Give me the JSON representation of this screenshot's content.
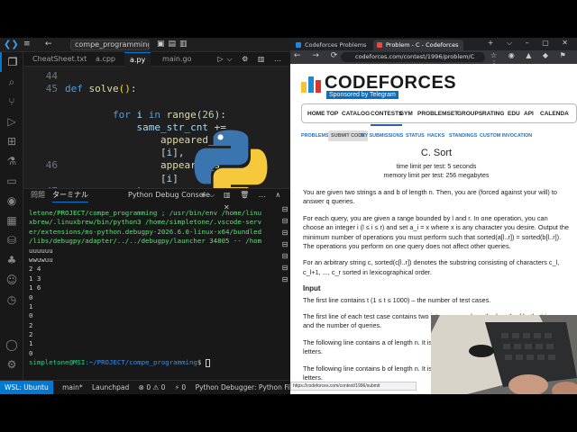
{
  "vscode": {
    "menu_icon": "≡",
    "nav_back": "←",
    "nav_fwd": "→",
    "search_text": "compe_programming [WS...",
    "tabs": [
      {
        "label": "CheatSheet.txt",
        "active": false
      },
      {
        "label": "a.cpp",
        "active": false
      },
      {
        "label": "a.py",
        "active": true
      },
      {
        "label": "main.go",
        "active": false
      }
    ],
    "editor_lines": [
      {
        "num": "44",
        "html": ""
      },
      {
        "num": "45",
        "html": "<span class=\"kw\">def</span> <span class=\"fn\">solve</span><span class=\"pn\">()</span>:"
      },
      {
        "num": "",
        "html": ""
      },
      {
        "num": "",
        "html": "        <span class=\"kw\">for</span> <span class=\"vr\">i</span> <span class=\"kw\">in</span> <span class=\"fn\">range</span>(<span class=\"nm\">26</span>):"
      },
      {
        "num": "",
        "html": "            <span class=\"vr\">same_str_cnt</span> +="
      },
      {
        "num": "",
        "html": "                <span class=\"fn\">appeared_s</span>            <span class=\"vr\">terval</span>"
      },
      {
        "num": "",
        "html": "                [<span class=\"vr\">i</span>],"
      },
      {
        "num": "46",
        "html": "                <span class=\"fn\">appeared_s</span>            <span class=\"vr\">terval</span>"
      },
      {
        "num": "",
        "html": "                [<span class=\"vr\">i</span>]"
      },
      {
        "num": "47",
        "html": "            )"
      },
      {
        "num": "",
        "html": ""
      }
    ],
    "panel_tabs": {
      "problems": "問題",
      "terminal": "ターミナル",
      "debug": "Python Debug Console",
      "plus": "+",
      "split": "⌵"
    },
    "terminal_lines": [
      "letone/PROJECT/compe_programming ; /usr/bin/env /home/linu",
      "xbrew/.linuxbrew/bin/python3 /home/simpletone/.vscode-serv",
      "er/extensions/ms-python.debugpy-2026.6.0-linux-x64/bundled",
      "/libs/debugpy/adapter/../../debugpy/launcher 34805 -- /hom",
      "uuuuuu",
      "wwuwuu",
      "2 4",
      "1 3",
      "1 6",
      "0",
      "1",
      "0",
      "2",
      "2",
      "1",
      "0"
    ],
    "prompt_user": "simpletone@MSI",
    "prompt_path": ":~/PROJECT/compe_programming",
    "prompt_sign": "$",
    "status": {
      "remote": "WSL: Ubuntu",
      "branch": "main*",
      "launchpad": "Launchpad",
      "errors": "⊗ 0 ⚠ 0",
      "ports": "⚡ 0",
      "debugger": "Python Debugger: Python File (compe"
    }
  },
  "browser": {
    "tabs": [
      {
        "label": "Codeforces Problems",
        "active": false
      },
      {
        "label": "Problem - C - Codeforces",
        "active": true
      }
    ],
    "url": "codeforces.com/contest/1996/problem/C",
    "site": {
      "logo_word": "CODEFORCES",
      "sponsor": "Sponsored by Telegram",
      "menu": [
        "HOME",
        "TOP",
        "CATALOG",
        "CONTESTS",
        "GYM",
        "PROBLEMSET",
        "GROUPS",
        "RATING",
        "EDU",
        "API",
        "CALENDA"
      ],
      "submenu": [
        "PROBLEMS",
        "SUBMIT CODE",
        "MY SUBMISSIONS",
        "STATUS",
        "HACKS",
        "STANDINGS",
        "CUSTOM INVOCATION"
      ]
    },
    "problem": {
      "title": "C. Sort",
      "time_limit": "time limit per test: 5 seconds",
      "memory_limit": "memory limit per test: 256 megabytes",
      "statement": [
        "You are given two strings a and b of length n. Then, you are (forced against your will) to answer q queries.",
        "For each query, you are given a range bounded by l and r. In one operation, you can choose an integer i (l ≤ i ≤ r) and set a_i = x where x is any character you desire. Output the minimum number of operations you must perform such that sorted(a[l..r]) = sorted(b[l..r]). The operations you perform on one query does not affect other queries.",
        "For an arbitrary string c, sorted(c[l..r]) denotes the substring consisting of characters c_l, c_l+1, ..., c_r sorted in lexicographical order."
      ],
      "input_heading": "Input",
      "input_lines": [
        "The first line contains t (1 ≤ t ≤ 1000) – the number of test cases.",
        "The first line of each test case contains two integers n and q – the length of both strings and the number of queries.",
        "The following line contains a of length n. It is guaranteed a only contains lowercase latin letters.",
        "The following line contains b of length n. It is guaranteed b only contains lowercase latin letters."
      ]
    },
    "status_url": "https://codeforces.com/contest/1996/submit"
  }
}
